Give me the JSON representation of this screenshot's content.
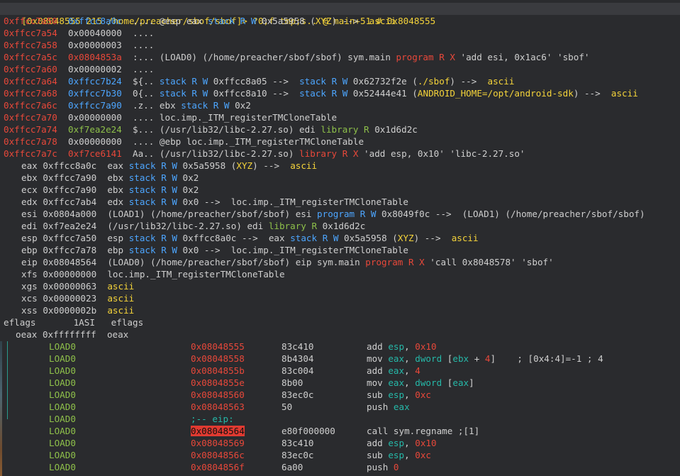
{
  "prompt": {
    "text": "[0x08048555 215 /home/preacher/sbof/sbof]> ?0;f tmp;s.. @ main+51 # 0x8048555"
  },
  "stack_rows": [
    {
      "addr": "0xffcc7a50",
      "val": "0xffcc8a0c",
      "val_color": "c-blue",
      "segs": [
        {
          "t": "  .... @esp eax ",
          "c": "c-gray"
        },
        {
          "t": "stack",
          "c": "c-blue"
        },
        {
          "t": " ",
          "c": "c-gray"
        },
        {
          "t": "R W",
          "c": "c-blue"
        },
        {
          "t": " 0x5a5958 (",
          "c": "c-gray"
        },
        {
          "t": "XYZ",
          "c": "c-yellow"
        },
        {
          "t": ") -->  ",
          "c": "c-gray"
        },
        {
          "t": "ascii",
          "c": "c-yellow"
        }
      ]
    },
    {
      "addr": "0xffcc7a54",
      "val": "0x00040000",
      "val_color": "c-gray",
      "segs": [
        {
          "t": "  ....",
          "c": "c-gray"
        }
      ]
    },
    {
      "addr": "0xffcc7a58",
      "val": "0x00000003",
      "val_color": "c-gray",
      "segs": [
        {
          "t": "  ....",
          "c": "c-gray"
        }
      ]
    },
    {
      "addr": "0xffcc7a5c",
      "val": "0x0804853a",
      "val_color": "c-red",
      "segs": [
        {
          "t": "  :... (LOAD0) (/home/preacher/sbof/sbof) sym.main ",
          "c": "c-gray"
        },
        {
          "t": "program",
          "c": "c-red"
        },
        {
          "t": " ",
          "c": "c-gray"
        },
        {
          "t": "R X",
          "c": "c-red"
        },
        {
          "t": " 'add esi, 0x1ac6' 'sbof'",
          "c": "c-gray"
        }
      ]
    },
    {
      "addr": "0xffcc7a60",
      "val": "0x00000002",
      "val_color": "c-gray",
      "segs": [
        {
          "t": "  ....",
          "c": "c-gray"
        }
      ]
    },
    {
      "addr": "0xffcc7a64",
      "val": "0xffcc7b24",
      "val_color": "c-blue",
      "segs": [
        {
          "t": "  ${.. ",
          "c": "c-gray"
        },
        {
          "t": "stack",
          "c": "c-blue"
        },
        {
          "t": " ",
          "c": "c-gray"
        },
        {
          "t": "R W",
          "c": "c-blue"
        },
        {
          "t": " 0xffcc8a05 -->  ",
          "c": "c-gray"
        },
        {
          "t": "stack",
          "c": "c-blue"
        },
        {
          "t": " ",
          "c": "c-gray"
        },
        {
          "t": "R W",
          "c": "c-blue"
        },
        {
          "t": " 0x62732f2e (",
          "c": "c-gray"
        },
        {
          "t": "./sbof",
          "c": "c-yellow"
        },
        {
          "t": ") -->  ",
          "c": "c-gray"
        },
        {
          "t": "ascii",
          "c": "c-yellow"
        }
      ]
    },
    {
      "addr": "0xffcc7a68",
      "val": "0xffcc7b30",
      "val_color": "c-blue",
      "segs": [
        {
          "t": "  0{.. ",
          "c": "c-gray"
        },
        {
          "t": "stack",
          "c": "c-blue"
        },
        {
          "t": " ",
          "c": "c-gray"
        },
        {
          "t": "R W",
          "c": "c-blue"
        },
        {
          "t": " 0xffcc8a10 -->  ",
          "c": "c-gray"
        },
        {
          "t": "stack",
          "c": "c-blue"
        },
        {
          "t": " ",
          "c": "c-gray"
        },
        {
          "t": "R W",
          "c": "c-blue"
        },
        {
          "t": " 0x52444e41 (",
          "c": "c-gray"
        },
        {
          "t": "ANDROID_HOME=/opt/android-sdk",
          "c": "c-yellow"
        },
        {
          "t": ") -->  ",
          "c": "c-gray"
        },
        {
          "t": "ascii",
          "c": "c-yellow"
        }
      ]
    },
    {
      "addr": "0xffcc7a6c",
      "val": "0xffcc7a90",
      "val_color": "c-blue",
      "segs": [
        {
          "t": "  .z.. ebx ",
          "c": "c-gray"
        },
        {
          "t": "stack",
          "c": "c-blue"
        },
        {
          "t": " ",
          "c": "c-gray"
        },
        {
          "t": "R W",
          "c": "c-blue"
        },
        {
          "t": " 0x2",
          "c": "c-gray"
        }
      ]
    },
    {
      "addr": "0xffcc7a70",
      "val": "0x00000000",
      "val_color": "c-gray",
      "segs": [
        {
          "t": "  .... loc.imp._ITM_registerTMCloneTable",
          "c": "c-gray"
        }
      ]
    },
    {
      "addr": "0xffcc7a74",
      "val": "0xf7ea2e24",
      "val_color": "c-green",
      "segs": [
        {
          "t": "  $... (/usr/lib32/libc-2.27.so) edi ",
          "c": "c-gray"
        },
        {
          "t": "library",
          "c": "c-green"
        },
        {
          "t": " ",
          "c": "c-gray"
        },
        {
          "t": "R",
          "c": "c-green"
        },
        {
          "t": " 0x1d6d2c",
          "c": "c-gray"
        }
      ]
    },
    {
      "addr": "0xffcc7a78",
      "val": "0x00000000",
      "val_color": "c-gray",
      "segs": [
        {
          "t": "  .... @ebp loc.imp._ITM_registerTMCloneTable",
          "c": "c-gray"
        }
      ]
    },
    {
      "addr": "0xffcc7a7c",
      "val": "0xf7ce6141",
      "val_color": "c-red",
      "segs": [
        {
          "t": "  Aa.. (/usr/lib32/libc-2.27.so) ",
          "c": "c-gray"
        },
        {
          "t": "library",
          "c": "c-red"
        },
        {
          "t": " ",
          "c": "c-gray"
        },
        {
          "t": "R X",
          "c": "c-red"
        },
        {
          "t": " 'add esp, 0x10' 'libc-2.27.so'",
          "c": "c-gray"
        }
      ]
    }
  ],
  "registers": [
    {
      "name": "eax",
      "val": "0xffcc8a0c",
      "segs": [
        {
          "t": "eax ",
          "c": "c-gray"
        },
        {
          "t": "stack",
          "c": "c-blue"
        },
        {
          "t": " ",
          "c": "c-gray"
        },
        {
          "t": "R W",
          "c": "c-blue"
        },
        {
          "t": " 0x5a5958 (",
          "c": "c-gray"
        },
        {
          "t": "XYZ",
          "c": "c-yellow"
        },
        {
          "t": ") -->  ",
          "c": "c-gray"
        },
        {
          "t": "ascii",
          "c": "c-yellow"
        }
      ]
    },
    {
      "name": "ebx",
      "val": "0xffcc7a90",
      "segs": [
        {
          "t": "ebx ",
          "c": "c-gray"
        },
        {
          "t": "stack",
          "c": "c-blue"
        },
        {
          "t": " ",
          "c": "c-gray"
        },
        {
          "t": "R W",
          "c": "c-blue"
        },
        {
          "t": " 0x2",
          "c": "c-gray"
        }
      ]
    },
    {
      "name": "ecx",
      "val": "0xffcc7a90",
      "segs": [
        {
          "t": "ebx ",
          "c": "c-gray"
        },
        {
          "t": "stack",
          "c": "c-blue"
        },
        {
          "t": " ",
          "c": "c-gray"
        },
        {
          "t": "R W",
          "c": "c-blue"
        },
        {
          "t": " 0x2",
          "c": "c-gray"
        }
      ]
    },
    {
      "name": "edx",
      "val": "0xffcc7ab4",
      "segs": [
        {
          "t": "edx ",
          "c": "c-gray"
        },
        {
          "t": "stack",
          "c": "c-blue"
        },
        {
          "t": " ",
          "c": "c-gray"
        },
        {
          "t": "R W",
          "c": "c-blue"
        },
        {
          "t": " 0x0 -->  loc.imp._ITM_registerTMCloneTable",
          "c": "c-gray"
        }
      ]
    },
    {
      "name": "esi",
      "val": "0x0804a000",
      "segs": [
        {
          "t": "(LOAD1) (/home/preacher/sbof/sbof) esi ",
          "c": "c-gray"
        },
        {
          "t": "program",
          "c": "c-blue"
        },
        {
          "t": " ",
          "c": "c-gray"
        },
        {
          "t": "R W",
          "c": "c-blue"
        },
        {
          "t": " 0x8049f0c -->  (LOAD1) (/home/preacher/sbof/sbof)",
          "c": "c-gray"
        }
      ]
    },
    {
      "name": "edi",
      "val": "0xf7ea2e24",
      "segs": [
        {
          "t": "(/usr/lib32/libc-2.27.so) edi ",
          "c": "c-gray"
        },
        {
          "t": "library",
          "c": "c-green"
        },
        {
          "t": " ",
          "c": "c-gray"
        },
        {
          "t": "R",
          "c": "c-green"
        },
        {
          "t": " 0x1d6d2c",
          "c": "c-gray"
        }
      ]
    },
    {
      "name": "esp",
      "val": "0xffcc7a50",
      "segs": [
        {
          "t": "esp ",
          "c": "c-gray"
        },
        {
          "t": "stack",
          "c": "c-blue"
        },
        {
          "t": " ",
          "c": "c-gray"
        },
        {
          "t": "R W",
          "c": "c-blue"
        },
        {
          "t": " 0xffcc8a0c -->  eax ",
          "c": "c-gray"
        },
        {
          "t": "stack",
          "c": "c-blue"
        },
        {
          "t": " ",
          "c": "c-gray"
        },
        {
          "t": "R W",
          "c": "c-blue"
        },
        {
          "t": " 0x5a5958 (",
          "c": "c-gray"
        },
        {
          "t": "XYZ",
          "c": "c-yellow"
        },
        {
          "t": ") -->  ",
          "c": "c-gray"
        },
        {
          "t": "ascii",
          "c": "c-yellow"
        }
      ]
    },
    {
      "name": "ebp",
      "val": "0xffcc7a78",
      "segs": [
        {
          "t": "ebp ",
          "c": "c-gray"
        },
        {
          "t": "stack",
          "c": "c-blue"
        },
        {
          "t": " ",
          "c": "c-gray"
        },
        {
          "t": "R W",
          "c": "c-blue"
        },
        {
          "t": " 0x0 -->  loc.imp._ITM_registerTMCloneTable",
          "c": "c-gray"
        }
      ]
    },
    {
      "name": "eip",
      "val": "0x08048564",
      "segs": [
        {
          "t": "(LOAD0) (/home/preacher/sbof/sbof) eip sym.main ",
          "c": "c-gray"
        },
        {
          "t": "program",
          "c": "c-red"
        },
        {
          "t": " ",
          "c": "c-gray"
        },
        {
          "t": "R X",
          "c": "c-red"
        },
        {
          "t": " 'call 0x8048578' 'sbof'",
          "c": "c-gray"
        }
      ]
    },
    {
      "name": "xfs",
      "val": "0x00000000",
      "segs": [
        {
          "t": "loc.imp._ITM_registerTMCloneTable",
          "c": "c-gray"
        }
      ]
    },
    {
      "name": "xgs",
      "val": "0x00000063",
      "segs": [
        {
          "t": "ascii",
          "c": "c-yellow"
        }
      ]
    },
    {
      "name": "xcs",
      "val": "0x00000023",
      "segs": [
        {
          "t": "ascii",
          "c": "c-yellow"
        }
      ]
    },
    {
      "name": "xss",
      "val": "0x0000002b",
      "segs": [
        {
          "t": "ascii",
          "c": "c-yellow"
        }
      ]
    }
  ],
  "eflags": {
    "name": "eflags",
    "val": "1ASI",
    "desc": "eflags"
  },
  "oeax": {
    "name": "oeax",
    "val": "0xffffffff",
    "desc": "oeax"
  },
  "disasm": [
    {
      "seg": "LOAD0",
      "addr": "0x08048555",
      "bytes": "83c410",
      "ops": [
        {
          "t": "add ",
          "c": "c-gray"
        },
        {
          "t": "esp",
          "c": "c-teal"
        },
        {
          "t": ", ",
          "c": "c-gray"
        },
        {
          "t": "0x10",
          "c": "c-red"
        }
      ],
      "hl": false
    },
    {
      "seg": "LOAD0",
      "addr": "0x08048558",
      "bytes": "8b4304",
      "ops": [
        {
          "t": "mov ",
          "c": "c-gray"
        },
        {
          "t": "eax",
          "c": "c-teal"
        },
        {
          "t": ", ",
          "c": "c-gray"
        },
        {
          "t": "dword",
          "c": "c-teal"
        },
        {
          "t": " [",
          "c": "c-gray"
        },
        {
          "t": "ebx",
          "c": "c-teal"
        },
        {
          "t": " + ",
          "c": "c-gray"
        },
        {
          "t": "4",
          "c": "c-red"
        },
        {
          "t": "]    ; [0x4:4]=-1 ; 4",
          "c": "c-gray"
        }
      ],
      "hl": false
    },
    {
      "seg": "LOAD0",
      "addr": "0x0804855b",
      "bytes": "83c004",
      "ops": [
        {
          "t": "add ",
          "c": "c-gray"
        },
        {
          "t": "eax",
          "c": "c-teal"
        },
        {
          "t": ", ",
          "c": "c-gray"
        },
        {
          "t": "4",
          "c": "c-red"
        }
      ],
      "hl": false
    },
    {
      "seg": "LOAD0",
      "addr": "0x0804855e",
      "bytes": "8b00",
      "ops": [
        {
          "t": "mov ",
          "c": "c-gray"
        },
        {
          "t": "eax",
          "c": "c-teal"
        },
        {
          "t": ", ",
          "c": "c-gray"
        },
        {
          "t": "dword",
          "c": "c-teal"
        },
        {
          "t": " [",
          "c": "c-gray"
        },
        {
          "t": "eax",
          "c": "c-teal"
        },
        {
          "t": "]",
          "c": "c-gray"
        }
      ],
      "hl": false
    },
    {
      "seg": "LOAD0",
      "addr": "0x08048560",
      "bytes": "83ec0c",
      "ops": [
        {
          "t": "sub ",
          "c": "c-gray"
        },
        {
          "t": "esp",
          "c": "c-teal"
        },
        {
          "t": ", ",
          "c": "c-gray"
        },
        {
          "t": "0xc",
          "c": "c-red"
        }
      ],
      "hl": false
    },
    {
      "seg": "LOAD0",
      "addr": "0x08048563",
      "bytes": "50",
      "ops": [
        {
          "t": "push ",
          "c": "c-gray"
        },
        {
          "t": "eax",
          "c": "c-teal"
        }
      ],
      "hl": false
    },
    {
      "seg": "LOAD0",
      "addr": "",
      "bytes": "",
      "label": ";-- eip:",
      "ops": [],
      "hl": false
    },
    {
      "seg": "LOAD0",
      "addr": "0x08048564",
      "bytes": "e80f000000",
      "ops": [
        {
          "t": "call sym.regname ;[1]",
          "c": "c-gray"
        }
      ],
      "hl": true
    },
    {
      "seg": "LOAD0",
      "addr": "0x08048569",
      "bytes": "83c410",
      "ops": [
        {
          "t": "add ",
          "c": "c-gray"
        },
        {
          "t": "esp",
          "c": "c-teal"
        },
        {
          "t": ", ",
          "c": "c-gray"
        },
        {
          "t": "0x10",
          "c": "c-red"
        }
      ],
      "hl": false
    },
    {
      "seg": "LOAD0",
      "addr": "0x0804856c",
      "bytes": "83ec0c",
      "ops": [
        {
          "t": "sub ",
          "c": "c-gray"
        },
        {
          "t": "esp",
          "c": "c-teal"
        },
        {
          "t": ", ",
          "c": "c-gray"
        },
        {
          "t": "0xc",
          "c": "c-red"
        }
      ],
      "hl": false
    },
    {
      "seg": "LOAD0",
      "addr": "0x0804856f",
      "bytes": "6a00",
      "ops": [
        {
          "t": "push ",
          "c": "c-gray"
        },
        {
          "t": "0",
          "c": "c-red"
        }
      ],
      "hl": false
    }
  ]
}
